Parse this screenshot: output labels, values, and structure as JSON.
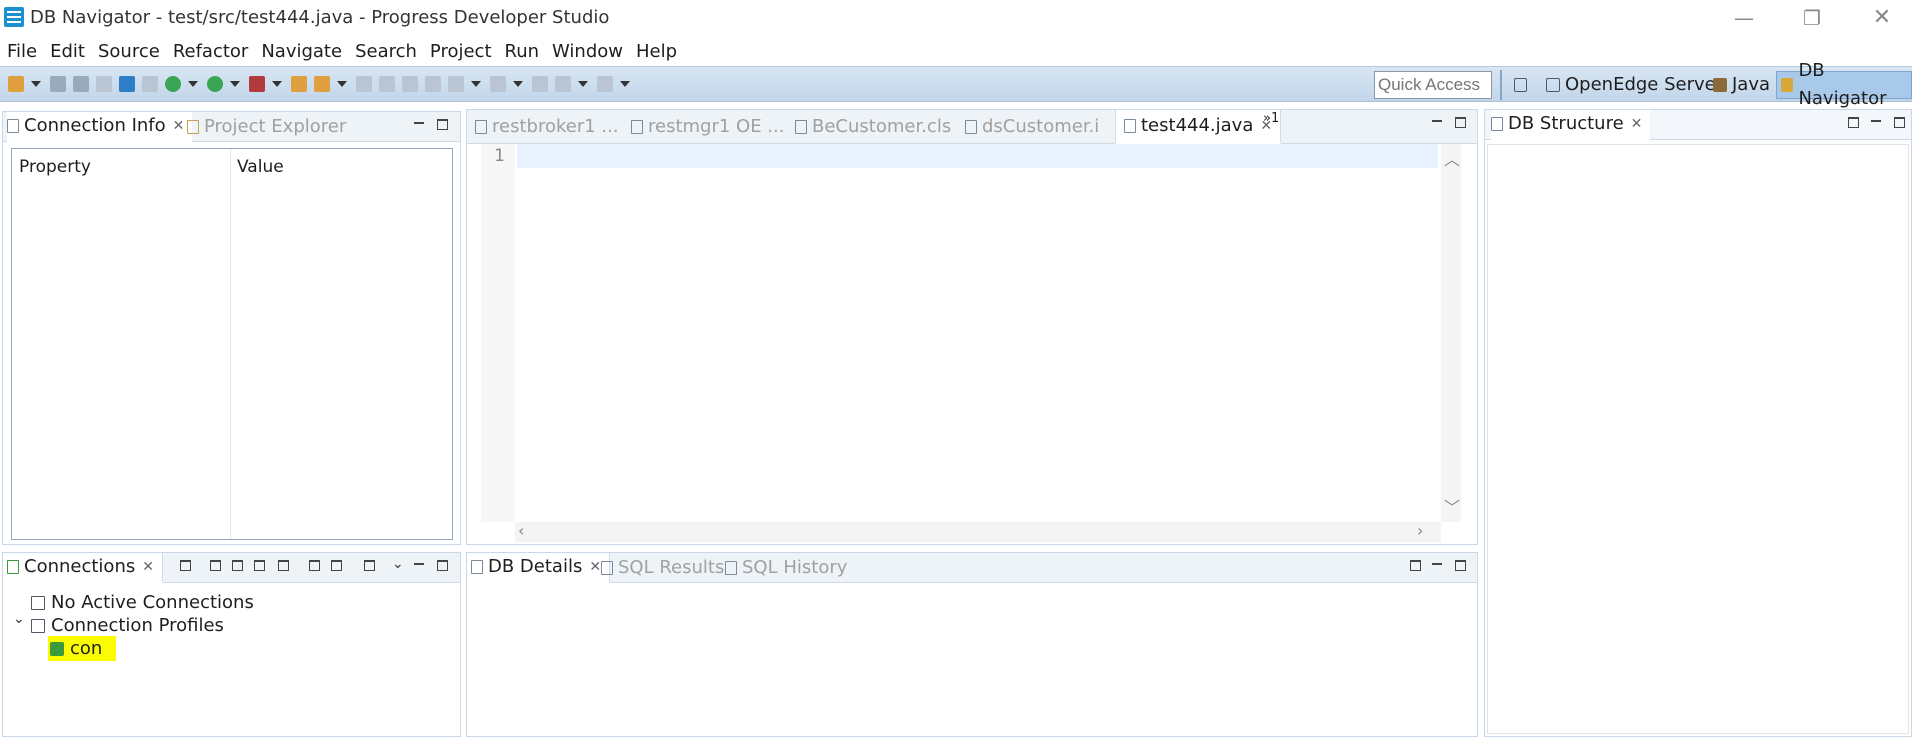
{
  "window": {
    "title": "DB Navigator - test/src/test444.java - Progress Developer Studio",
    "minimize": "—",
    "restore": "❐",
    "close": "✕"
  },
  "menu": [
    "File",
    "Edit",
    "Source",
    "Refactor",
    "Navigate",
    "Search",
    "Project",
    "Run",
    "Window",
    "Help"
  ],
  "toolbar": {
    "quick_access_placeholder": "Quick Access"
  },
  "perspectives": {
    "openedge": "OpenEdge Server",
    "java": "Java",
    "db_navigator": "DB Navigator"
  },
  "left_top": {
    "tabs": {
      "connection_info": "Connection Info",
      "project_explorer": "Project Explorer"
    },
    "table": {
      "headers": [
        "Property",
        "Value"
      ]
    }
  },
  "editor": {
    "tabs": [
      "restbroker1 ...",
      "restmgr1 OE ...",
      "BeCustomer.cls",
      "dsCustomer.i",
      "test444.java"
    ],
    "overflow": "»1",
    "line_numbers": [
      "1"
    ]
  },
  "right": {
    "tab": "DB Structure"
  },
  "left_bottom": {
    "tab": "Connections",
    "tree": {
      "no_active": "No Active Connections",
      "profiles": "Connection Profiles",
      "profile_item": "con"
    }
  },
  "bottom_center": {
    "tabs": {
      "db_details": "DB Details",
      "sql_results": "SQL Results",
      "sql_history": "SQL History"
    }
  },
  "icons": {
    "close_tab": "✕",
    "caret_down": "⌄"
  }
}
